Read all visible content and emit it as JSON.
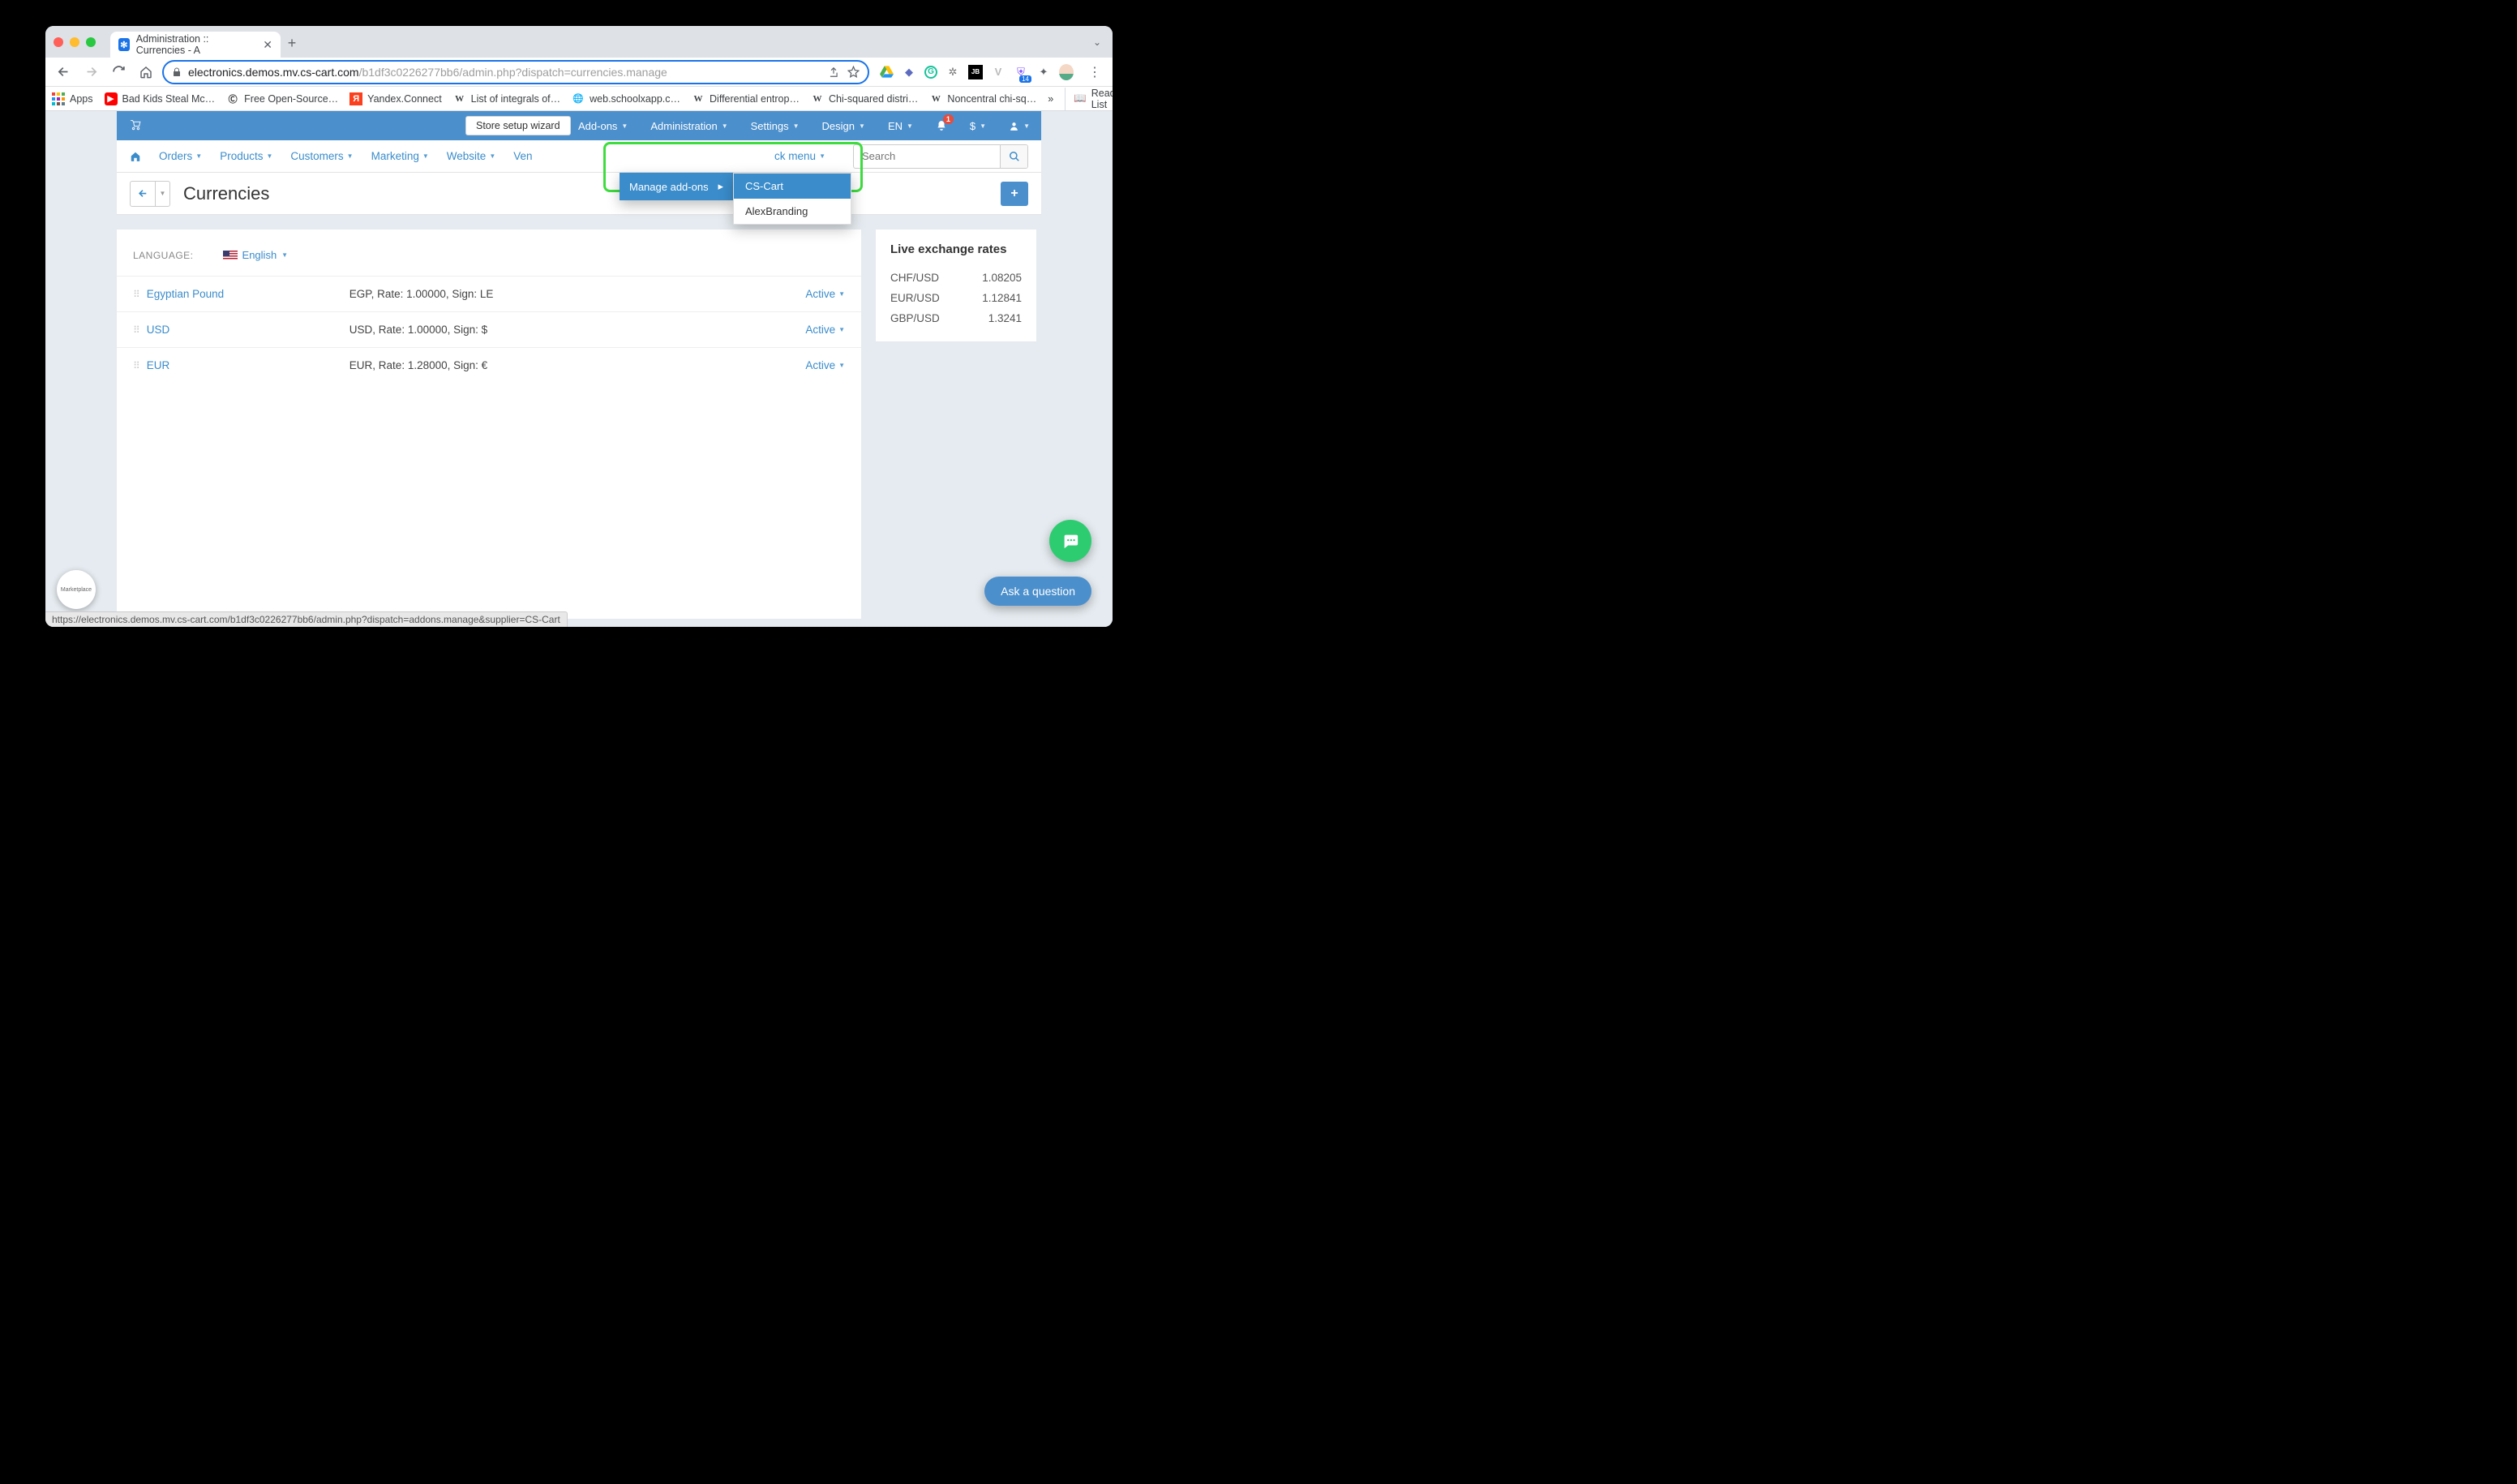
{
  "browser": {
    "tab_title": "Administration :: Currencies - A",
    "url_host": "electronics.demos.mv.cs-cart.com",
    "url_path": "/b1df3c0226277bb6/admin.php?dispatch=currencies.manage",
    "bookmarks": {
      "apps": "Apps",
      "b1": "Bad Kids Steal Mc…",
      "b2": "Free Open-Source…",
      "b3": "Yandex.Connect",
      "b4": "List of integrals of…",
      "b5": "web.schoolxapp.c…",
      "b6": "Differential entrop…",
      "b7": "Chi-squared distri…",
      "b8": "Noncentral chi-sq…",
      "more": "»",
      "reading": "Reading List"
    },
    "ext_badge": "14"
  },
  "topbar": {
    "wizard": "Store setup wizard",
    "addons": "Add-ons",
    "administration": "Administration",
    "settings": "Settings",
    "design": "Design",
    "lang": "EN",
    "currency": "$",
    "notif_count": "1"
  },
  "navbar": {
    "orders": "Orders",
    "products": "Products",
    "customers": "Customers",
    "marketing": "Marketing",
    "website": "Website",
    "vendors_partial": "Ven",
    "quick_partial": "ck menu",
    "search_placeholder": "Search"
  },
  "dropdown": {
    "manage": "Manage add-ons",
    "item_cscart": "CS-Cart",
    "item_alex": "AlexBranding"
  },
  "page": {
    "title": "Currencies",
    "lang_label": "LANGUAGE:",
    "lang_value": "English"
  },
  "currencies": [
    {
      "name": "Egyptian Pound",
      "desc": "EGP, Rate: 1.00000, Sign: LE",
      "status": "Active"
    },
    {
      "name": "USD",
      "desc": "USD, Rate: 1.00000, Sign: $",
      "status": "Active"
    },
    {
      "name": "EUR",
      "desc": "EUR, Rate: 1.28000, Sign: €",
      "status": "Active"
    }
  ],
  "side": {
    "title": "Live exchange rates",
    "rates": [
      {
        "pair": "CHF/USD",
        "val": "1.08205"
      },
      {
        "pair": "EUR/USD",
        "val": "1.12841"
      },
      {
        "pair": "GBP/USD",
        "val": "1.3241"
      }
    ]
  },
  "floating": {
    "ask": "Ask a question",
    "logo": "Marketplace"
  },
  "status_url": "https://electronics.demos.mv.cs-cart.com/b1df3c0226277bb6/admin.php?dispatch=addons.manage&supplier=CS-Cart"
}
